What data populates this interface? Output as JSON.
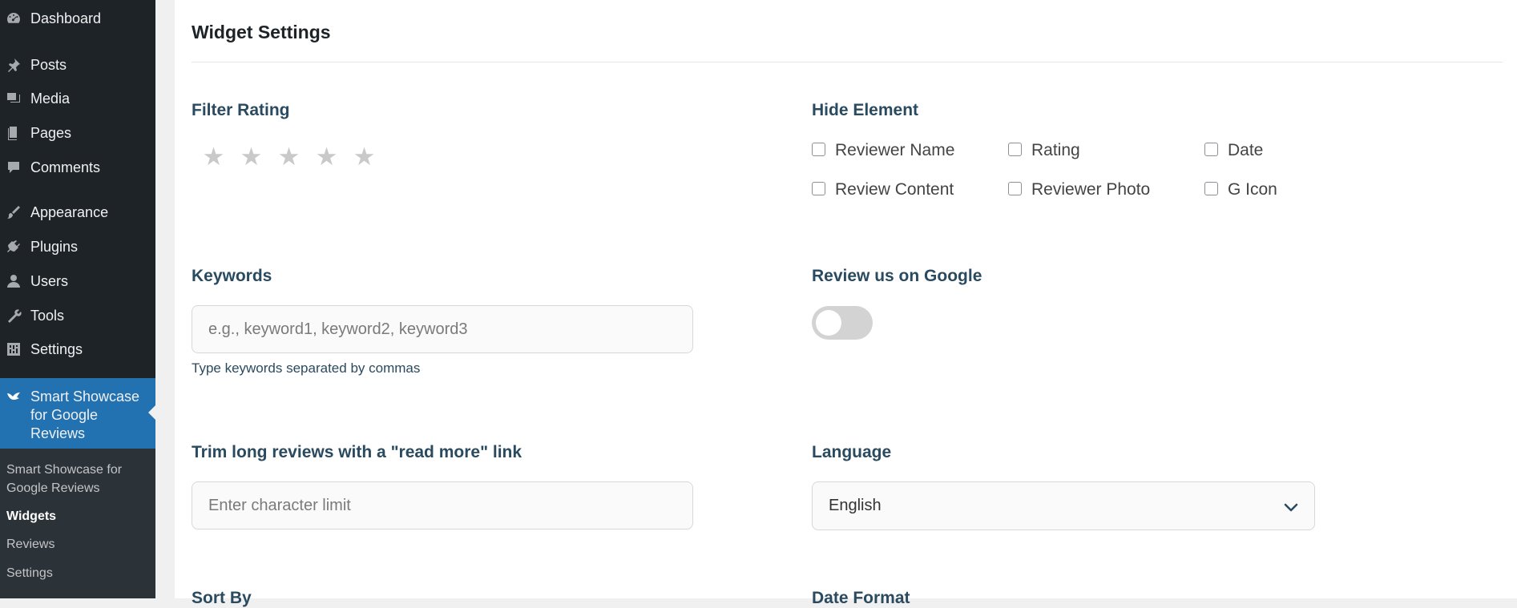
{
  "sidebar": {
    "items": [
      {
        "label": "Dashboard",
        "icon": "dashboard-icon"
      },
      {
        "label": "Posts",
        "icon": "pin-icon"
      },
      {
        "label": "Media",
        "icon": "media-icon"
      },
      {
        "label": "Pages",
        "icon": "pages-icon"
      },
      {
        "label": "Comments",
        "icon": "comment-icon"
      },
      {
        "label": "Appearance",
        "icon": "brush-icon"
      },
      {
        "label": "Plugins",
        "icon": "plugin-icon"
      },
      {
        "label": "Users",
        "icon": "user-icon"
      },
      {
        "label": "Tools",
        "icon": "wrench-icon"
      },
      {
        "label": "Settings",
        "icon": "settings-icon"
      }
    ],
    "active": {
      "label": "Smart Showcase for Google Reviews",
      "icon": "bird-icon"
    },
    "submenu": [
      {
        "label": "Smart Showcase for Google Reviews"
      },
      {
        "label": "Widgets"
      },
      {
        "label": "Reviews"
      },
      {
        "label": "Settings"
      }
    ],
    "colors": {
      "background": "#1d2327",
      "active": "#2271b1",
      "submenu": "#2c3338"
    }
  },
  "main": {
    "title": "Widget Settings",
    "filter_rating": {
      "label": "Filter Rating",
      "stars": 5,
      "selected": 0
    },
    "hide_element": {
      "label": "Hide Element",
      "options": [
        {
          "label": "Reviewer Name",
          "checked": false
        },
        {
          "label": "Rating",
          "checked": false
        },
        {
          "label": "Date",
          "checked": false
        },
        {
          "label": "Review Content",
          "checked": false
        },
        {
          "label": "Reviewer Photo",
          "checked": false
        },
        {
          "label": "G Icon",
          "checked": false
        }
      ]
    },
    "keywords": {
      "label": "Keywords",
      "placeholder": "e.g., keyword1, keyword2, keyword3",
      "value": "",
      "help": "Type keywords separated by commas"
    },
    "review_us": {
      "label": "Review us on Google",
      "enabled": false
    },
    "trim": {
      "label": "Trim long reviews with a \"read more\" link",
      "placeholder": "Enter character limit",
      "value": ""
    },
    "language": {
      "label": "Language",
      "value": "English"
    },
    "sort_by": {
      "label": "Sort By"
    },
    "date_format": {
      "label": "Date Format"
    },
    "colors": {
      "label_text": "#2a4a5f",
      "star_empty": "#c9c9c9",
      "toggle_off": "#d3d3d3"
    }
  }
}
